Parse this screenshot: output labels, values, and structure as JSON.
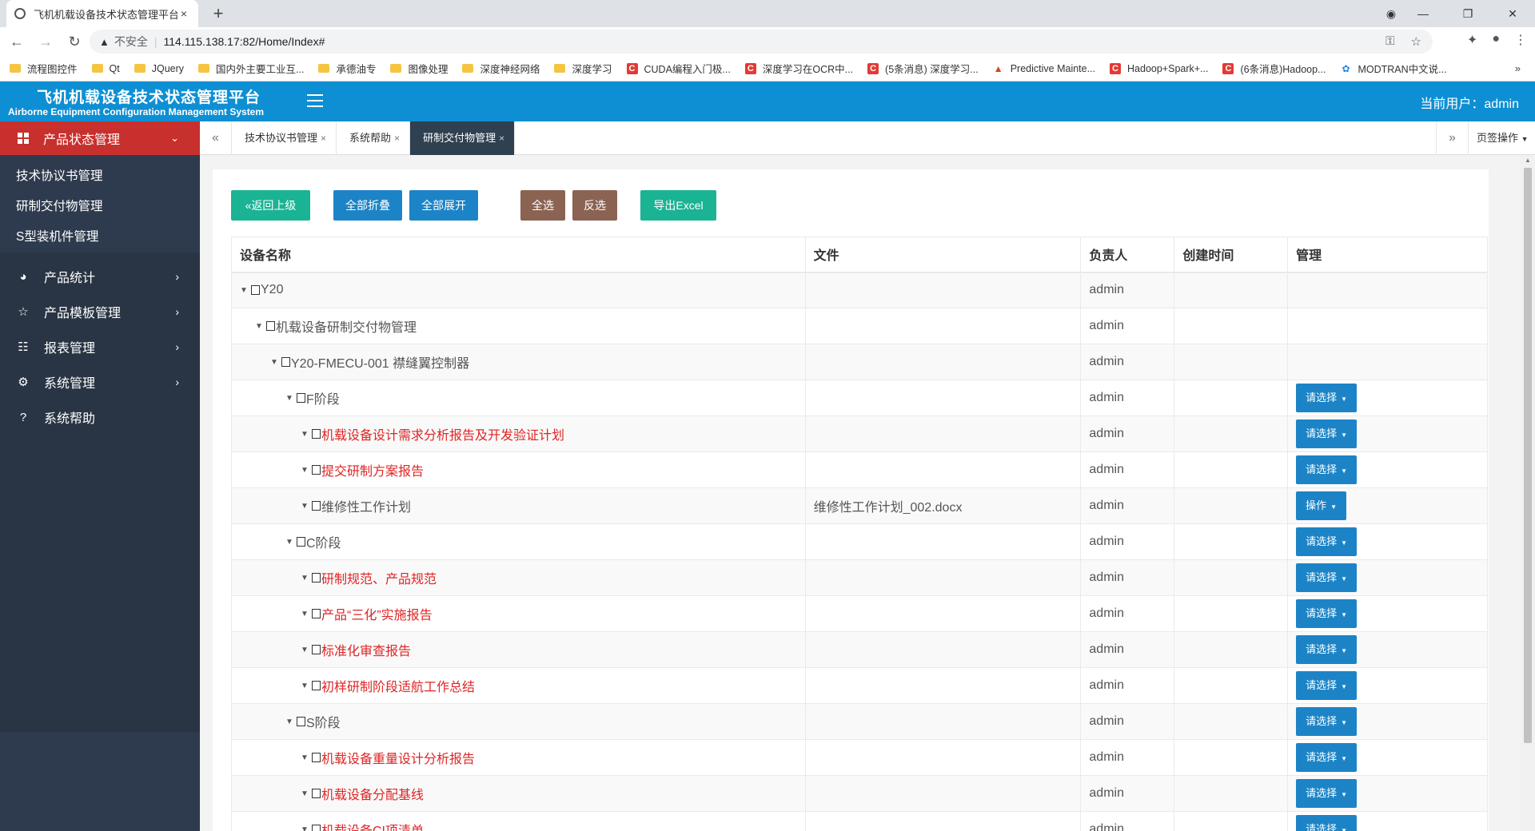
{
  "browser": {
    "tab_title": "飞机机载设备技术状态管理平台",
    "tab_close": "×",
    "new_tab": "+",
    "insecure_label": "不安全",
    "url": "114.115.138.17:82/Home/Index#",
    "bookmarks": [
      {
        "icon": "folder",
        "label": "流程图控件"
      },
      {
        "icon": "folder",
        "label": "Qt"
      },
      {
        "icon": "folder",
        "label": "JQuery"
      },
      {
        "icon": "folder",
        "label": "国内外主要工业互..."
      },
      {
        "icon": "folder",
        "label": "承德油专"
      },
      {
        "icon": "folder",
        "label": "图像处理"
      },
      {
        "icon": "folder",
        "label": "深度神经网络"
      },
      {
        "icon": "folder",
        "label": "深度学习"
      },
      {
        "icon": "csdn",
        "label": "CUDA编程入门极..."
      },
      {
        "icon": "csdn",
        "label": "深度学习在OCR中..."
      },
      {
        "icon": "csdn",
        "label": "(5条消息) 深度学习..."
      },
      {
        "icon": "matlab",
        "label": "Predictive Mainte..."
      },
      {
        "icon": "csdn",
        "label": "Hadoop+Spark+..."
      },
      {
        "icon": "csdn",
        "label": "(6条消息)Hadoop..."
      },
      {
        "icon": "paw",
        "label": "MODTRAN中文说..."
      }
    ]
  },
  "header": {
    "brand_cn": "飞机机载设备技术状态管理平台",
    "brand_en": "Airborne Equipment Configuration Management System",
    "current_user": "当前用户：admin"
  },
  "sidebar": {
    "active_group": "产品状态管理",
    "sub_items": [
      "技术协议书管理",
      "研制交付物管理",
      "S型装机件管理"
    ],
    "menu": [
      {
        "icon": "pie-chart-icon",
        "glyph": "◕",
        "label": "产品统计"
      },
      {
        "icon": "star-icon",
        "glyph": "☆",
        "label": "产品模板管理"
      },
      {
        "icon": "list-icon",
        "glyph": "☷",
        "label": "报表管理"
      },
      {
        "icon": "gear-icon",
        "glyph": "⚙",
        "label": "系统管理"
      },
      {
        "icon": "help-icon",
        "glyph": "?",
        "label": "系统帮助"
      }
    ]
  },
  "pagetabs": {
    "tabs": [
      "技术协议书管理",
      "系统帮助",
      "研制交付物管理"
    ],
    "close": "×",
    "active_index": 2,
    "page_ops": "页签操作"
  },
  "toolbar": {
    "back": "返回上级",
    "collapse_all": "全部折叠",
    "expand_all": "全部展开",
    "select_all": "全选",
    "invert": "反选",
    "export": "导出Excel"
  },
  "table": {
    "columns": [
      "设备名称",
      "文件",
      "负责人",
      "创建时间",
      "管理"
    ],
    "rows": [
      {
        "level": 0,
        "name": "Y20",
        "red": false,
        "file": "",
        "owner": "admin",
        "created": "",
        "action": ""
      },
      {
        "level": 1,
        "name": "机载设备研制交付物管理",
        "red": false,
        "file": "",
        "owner": "admin",
        "created": "",
        "action": ""
      },
      {
        "level": 2,
        "name": "Y20-FMECU-001 襟缝翼控制器",
        "red": false,
        "file": "",
        "owner": "admin",
        "created": "",
        "action": ""
      },
      {
        "level": 3,
        "name": "F阶段",
        "red": false,
        "file": "",
        "owner": "admin",
        "created": "",
        "action": "请选择"
      },
      {
        "level": 4,
        "name": "机载设备设计需求分析报告及开发验证计划",
        "red": true,
        "file": "",
        "owner": "admin",
        "created": "",
        "action": "请选择"
      },
      {
        "level": 4,
        "name": "提交研制方案报告",
        "red": true,
        "file": "",
        "owner": "admin",
        "created": "",
        "action": "请选择"
      },
      {
        "level": 4,
        "name": "维修性工作计划",
        "red": false,
        "file": "维修性工作计划_002.docx",
        "owner": "admin",
        "created": "",
        "action": "操作"
      },
      {
        "level": 3,
        "name": "C阶段",
        "red": false,
        "file": "",
        "owner": "admin",
        "created": "",
        "action": "请选择"
      },
      {
        "level": 4,
        "name": "研制规范、产品规范",
        "red": true,
        "file": "",
        "owner": "admin",
        "created": "",
        "action": "请选择"
      },
      {
        "level": 4,
        "name": "产品“三化”实施报告",
        "red": true,
        "file": "",
        "owner": "admin",
        "created": "",
        "action": "请选择"
      },
      {
        "level": 4,
        "name": "标准化审查报告",
        "red": true,
        "file": "",
        "owner": "admin",
        "created": "",
        "action": "请选择"
      },
      {
        "level": 4,
        "name": "初样研制阶段适航工作总结",
        "red": true,
        "file": "",
        "owner": "admin",
        "created": "",
        "action": "请选择"
      },
      {
        "level": 3,
        "name": "S阶段",
        "red": false,
        "file": "",
        "owner": "admin",
        "created": "",
        "action": "请选择"
      },
      {
        "level": 4,
        "name": "机载设备重量设计分析报告",
        "red": true,
        "file": "",
        "owner": "admin",
        "created": "",
        "action": "请选择"
      },
      {
        "level": 4,
        "name": "机载设备分配基线",
        "red": true,
        "file": "",
        "owner": "admin",
        "created": "",
        "action": "请选择"
      },
      {
        "level": 4,
        "name": "机载设备CI项清单",
        "red": true,
        "file": "",
        "owner": "admin",
        "created": "",
        "action": "请选择"
      }
    ]
  },
  "colors": {
    "header_blue": "#0e8fd3",
    "sidebar_dark": "#2e3b4e",
    "active_red": "#c8302d",
    "btn_green": "#1ab394",
    "btn_blue": "#1c84c6",
    "btn_brown": "#8a6353",
    "text_red": "#e02424"
  }
}
